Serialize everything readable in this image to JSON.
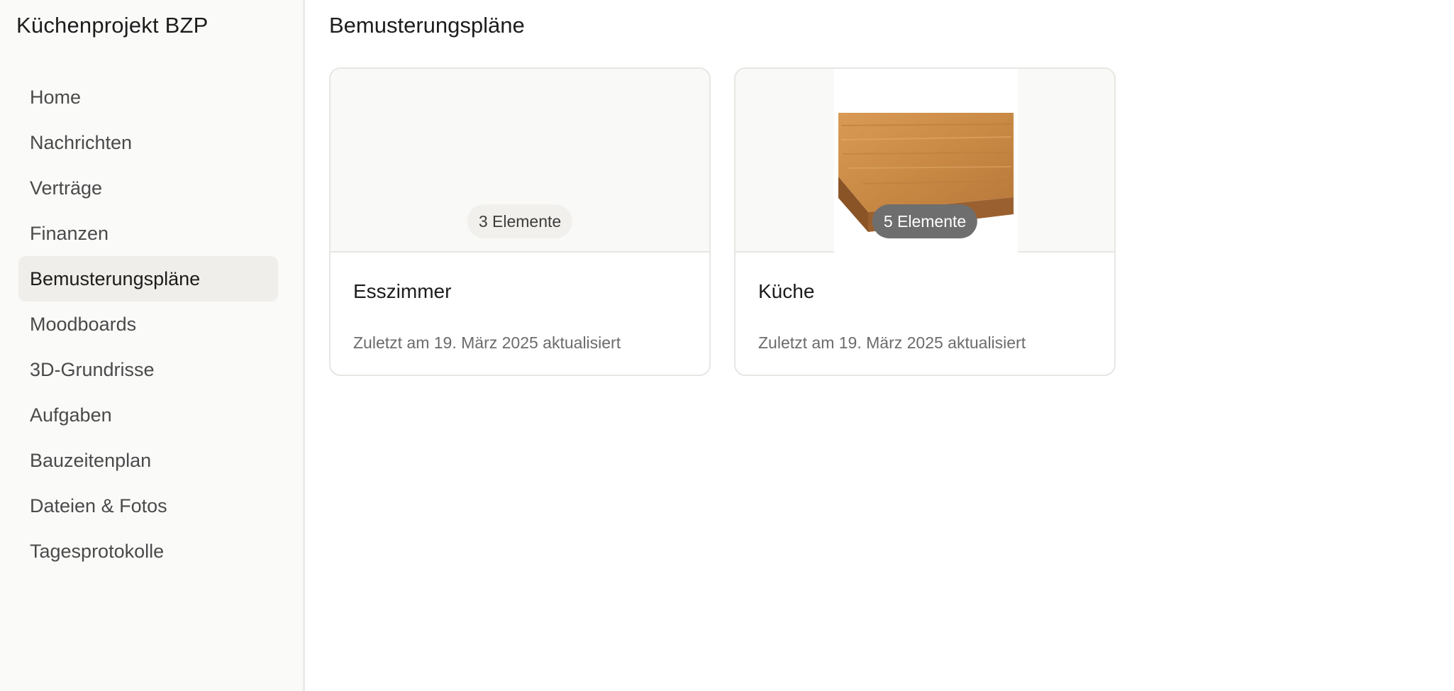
{
  "sidebar": {
    "project_title": "Küchenprojekt BZP",
    "items": [
      {
        "label": "Home"
      },
      {
        "label": "Nachrichten"
      },
      {
        "label": "Verträge"
      },
      {
        "label": "Finanzen"
      },
      {
        "label": "Bemusterungspläne",
        "active": true
      },
      {
        "label": "Moodboards"
      },
      {
        "label": "3D-Grundrisse"
      },
      {
        "label": "Aufgaben"
      },
      {
        "label": "Bauzeitenplan"
      },
      {
        "label": "Dateien & Fotos"
      },
      {
        "label": "Tagesprotokolle"
      }
    ]
  },
  "main": {
    "page_title": "Bemusterungspläne",
    "cards": [
      {
        "title": "Esszimmer",
        "count_label": "3 Elemente",
        "updated": "Zuletzt am 19. März 2025 aktualisiert"
      },
      {
        "title": "Küche",
        "count_label": "5 Elemente",
        "updated": "Zuletzt am 19. März 2025 aktualisiert",
        "thumbnail": "wooden-countertop-image"
      }
    ]
  },
  "colors": {
    "sidebar_bg": "#fafaf9",
    "active_nav_bg": "#efeeea",
    "badge_dark": "#6e6e6e",
    "badge_light": "#f1f0ec",
    "wood": "#c98a45"
  }
}
